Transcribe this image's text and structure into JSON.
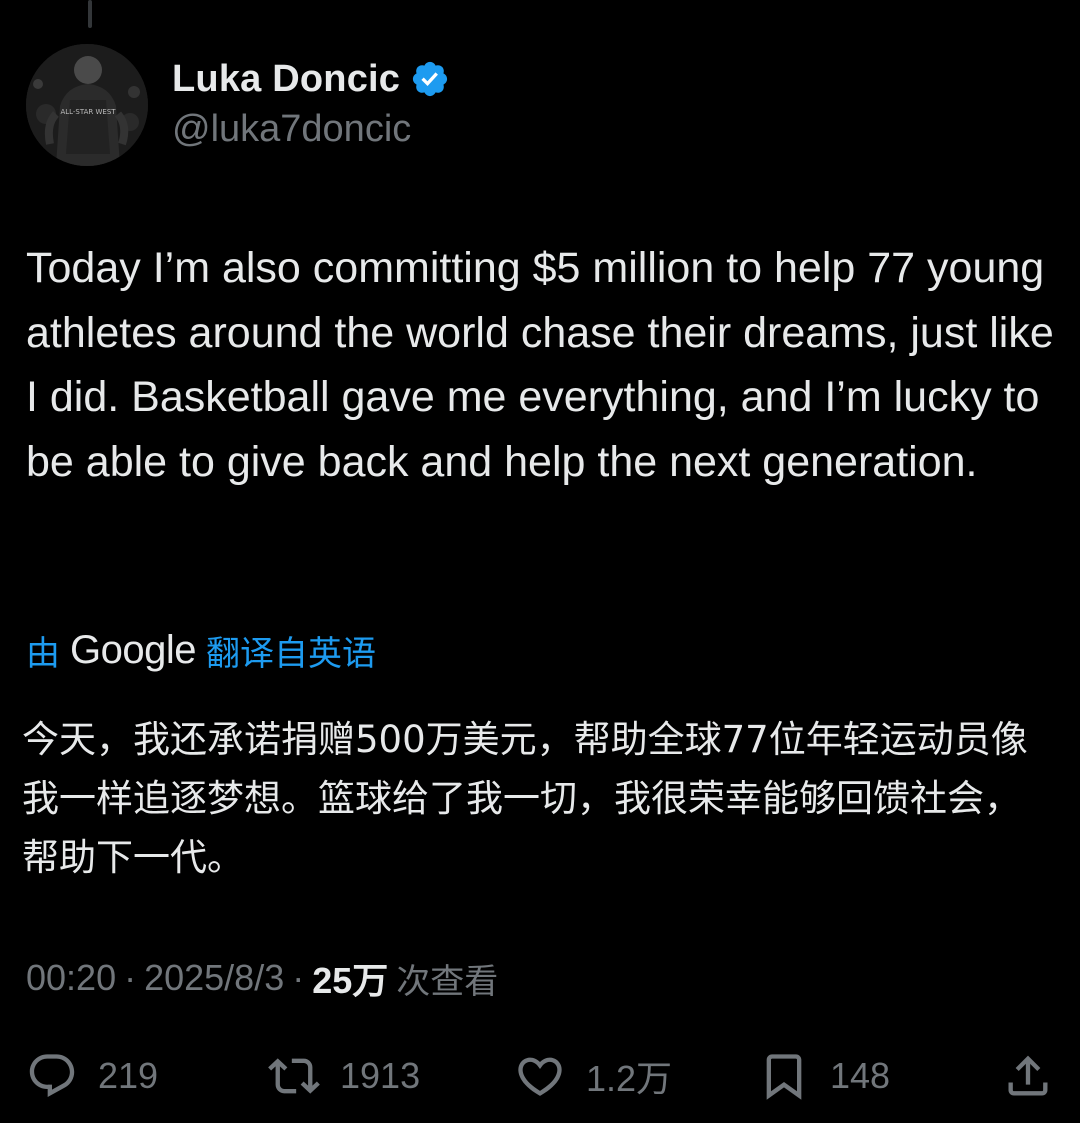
{
  "author": {
    "display_name": "Luka Doncic",
    "handle": "@luka7doncic",
    "verified_icon": "verified-badge-icon",
    "avatar_jersey_text": "ALL-STAR WEST"
  },
  "tweet": {
    "text": "Today I’m also committing $5 million to help 77 young athletes around the world chase their dreams, just like I did. Basketball gave me everything, and I’m lucky to be able to give back and help the next generation."
  },
  "translation": {
    "prefix": "由",
    "provider": "Google",
    "suffix": "翻译自英语",
    "text": "今天，我还承诺捐赠500万美元，帮助全球77位年轻运动员像我一样追逐梦想。篮球给了我一切，我很荣幸能够回馈社会，帮助下一代。"
  },
  "meta": {
    "time": "00:20",
    "date": "2025/8/3",
    "views_count": "25万",
    "views_label": "次查看",
    "separator": "·"
  },
  "actions": {
    "replies": "219",
    "reposts": "1913",
    "likes": "1.2万",
    "bookmarks": "148"
  },
  "colors": {
    "background": "#000000",
    "text": "#e7e9ea",
    "secondary": "#71767b",
    "accent": "#1d9bf0"
  }
}
